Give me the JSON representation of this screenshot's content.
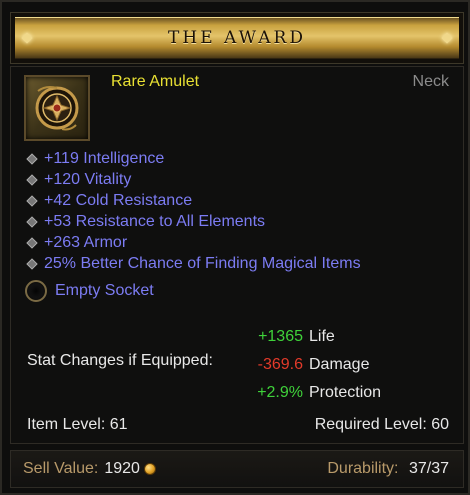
{
  "title": "THE AWARD",
  "item": {
    "type": "Rare Amulet",
    "slot": "Neck",
    "icon": "amulet-icon"
  },
  "affixes": [
    "+119 Intelligence",
    "+120 Vitality",
    "+42 Cold Resistance",
    "+53 Resistance to All Elements",
    "+263 Armor",
    "25% Better Chance of Finding Magical Items"
  ],
  "socket": "Empty Socket",
  "stat_changes": {
    "label": "Stat Changes if Equipped:",
    "rows": [
      {
        "value": "+1365",
        "name": "Life",
        "sign": "positive"
      },
      {
        "value": "-369.6",
        "name": "Damage",
        "sign": "negative"
      },
      {
        "value": "+2.9%",
        "name": "Protection",
        "sign": "positive"
      }
    ]
  },
  "item_level": "Item Level: 61",
  "required_level": "Required Level: 60",
  "footer": {
    "sell_label": "Sell Value:",
    "sell_value": "1920",
    "durability_label": "Durability:",
    "durability_value": "37/37"
  },
  "colors": {
    "rare": "#e8e033",
    "magic": "#7c7cf3",
    "positive": "#3fd23a",
    "negative": "#e23a2a",
    "gold_label": "#b89a6a"
  }
}
